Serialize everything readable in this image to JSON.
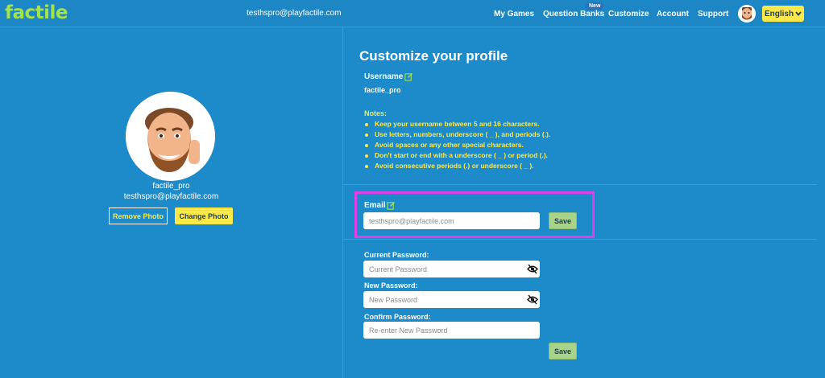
{
  "app": {
    "logo": "factile",
    "user_email": "testhspro@playfactile.com"
  },
  "nav": {
    "items": [
      "My Games",
      "Question Banks",
      "Customize",
      "Account",
      "Support"
    ],
    "new_badge": "New",
    "language": "English"
  },
  "profile": {
    "username": "factile_pro",
    "email": "testhspro@playfactile.com",
    "remove_photo": "Remove Photo",
    "change_photo": "Change Photo"
  },
  "main": {
    "title": "Customize your profile",
    "username_label": "Username",
    "username_value": "factile_pro",
    "notes_title": "Notes:",
    "notes": [
      "Keep your username between 5 and 16 characters.",
      "Use letters, numbers, underscore ( _ ), and periods (.).",
      "Avoid spaces or any other special characters.",
      "Don't start or end with a underscore ( _ ) or period (.).",
      "Avoid consecutive periods (.) or underscore ( _ )."
    ],
    "email_label": "Email",
    "email_placeholder": "testhspro@playfactile.com",
    "save": "Save",
    "current_password_label": "Current Password:",
    "current_password_placeholder": "Current Password",
    "new_password_label": "New Password:",
    "new_password_placeholder": "New Password",
    "confirm_password_label": "Confirm Password:",
    "confirm_password_placeholder": "Re-enter New Password"
  },
  "colors": {
    "background": "#1d8bc9",
    "accent_yellow": "#fde84a",
    "logo_green": "#a4e24a",
    "save_green": "#a8d38a",
    "highlight": "#e040ea"
  }
}
